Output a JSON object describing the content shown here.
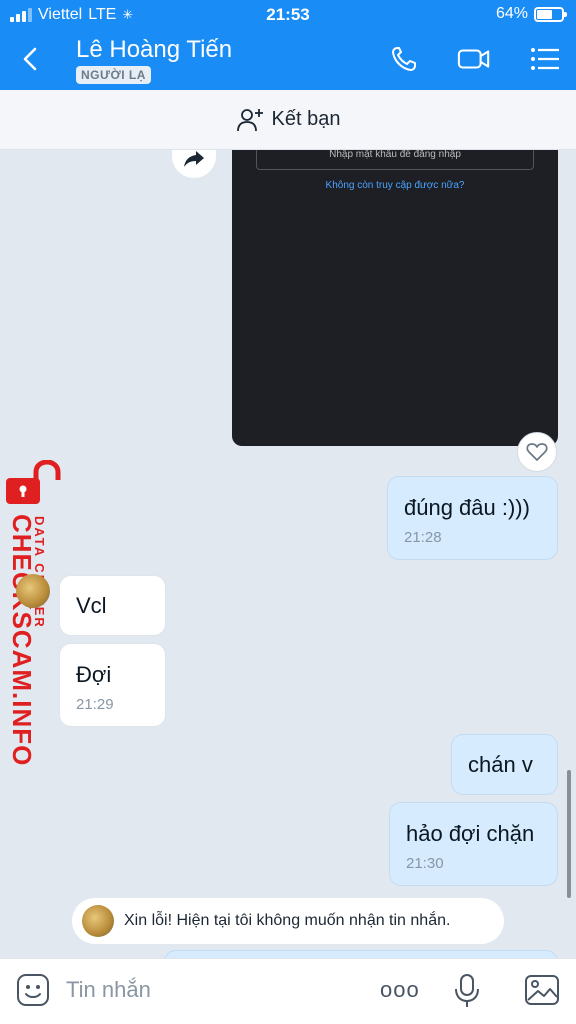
{
  "status_bar": {
    "carrier": "Viettel",
    "network": "LTE",
    "time": "21:53",
    "battery_text": "64%",
    "battery_level": 0.64
  },
  "header": {
    "contact_name": "Lê Hoàng Tiến",
    "badge": "NGƯỜI LẠ",
    "icons": [
      "back-icon",
      "phone-icon",
      "video-icon",
      "menu-icon"
    ]
  },
  "friend_bar": {
    "label": "Kết bạn",
    "icon": "add-friend-icon"
  },
  "shared_image": {
    "password_field_text": "Nhập mật khẩu để đăng nhập",
    "link_text": "Không còn truy cập được nữa?"
  },
  "messages": [
    {
      "direction": "out",
      "text": "đúng đâu :)))",
      "time": "21:28"
    },
    {
      "direction": "in",
      "text": "Vcl",
      "time": ""
    },
    {
      "direction": "in",
      "text": "Đợi",
      "time": "21:29"
    },
    {
      "direction": "out",
      "text": "chán v",
      "time": ""
    },
    {
      "direction": "out",
      "text": "hảo đợi chặn",
      "time": "21:30"
    }
  ],
  "watermark": {
    "line1": "DATA CENTER",
    "line2": "CHECKSCAM.INFO"
  },
  "notice": {
    "text": "Xin lỗi! Hiện tại tôi không muốn nhận tin nhắn."
  },
  "composer": {
    "placeholder": "Tin nhắn",
    "more_glyph": "ooo",
    "icons": [
      "sticker-icon",
      "more-icon",
      "microphone-icon",
      "image-icon"
    ]
  },
  "colors": {
    "header_blue": "#1a8cf6",
    "outgoing_bubble": "#d6ebfd",
    "incoming_bubble": "#ffffff",
    "chat_background": "#e2e8f0",
    "watermark_red": "#e02020"
  }
}
